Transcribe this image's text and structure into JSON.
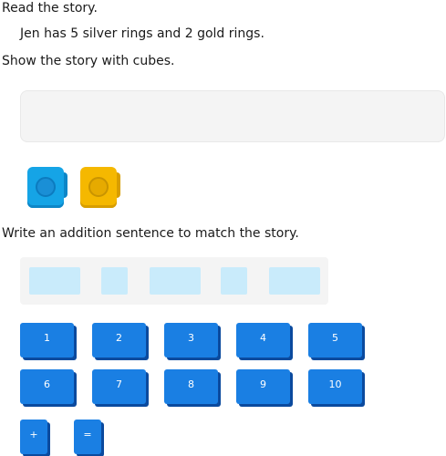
{
  "instructions": {
    "read": "Read the story.",
    "story": "Jen has 5 silver rings and 2 gold rings.",
    "show": "Show the story with cubes.",
    "write": "Write an addition sentence to match the story."
  },
  "cubes": [
    {
      "color": "#15a4e6",
      "name": "blue"
    },
    {
      "color": "#f5b800",
      "name": "gold"
    }
  ],
  "tiles": {
    "row1": [
      "1",
      "2",
      "3",
      "4",
      "5"
    ],
    "row2": [
      "6",
      "7",
      "8",
      "9",
      "10"
    ],
    "operators": [
      "+",
      "="
    ]
  },
  "colors": {
    "tile": "#1a7fe3",
    "slot": "#c9ebfb"
  }
}
